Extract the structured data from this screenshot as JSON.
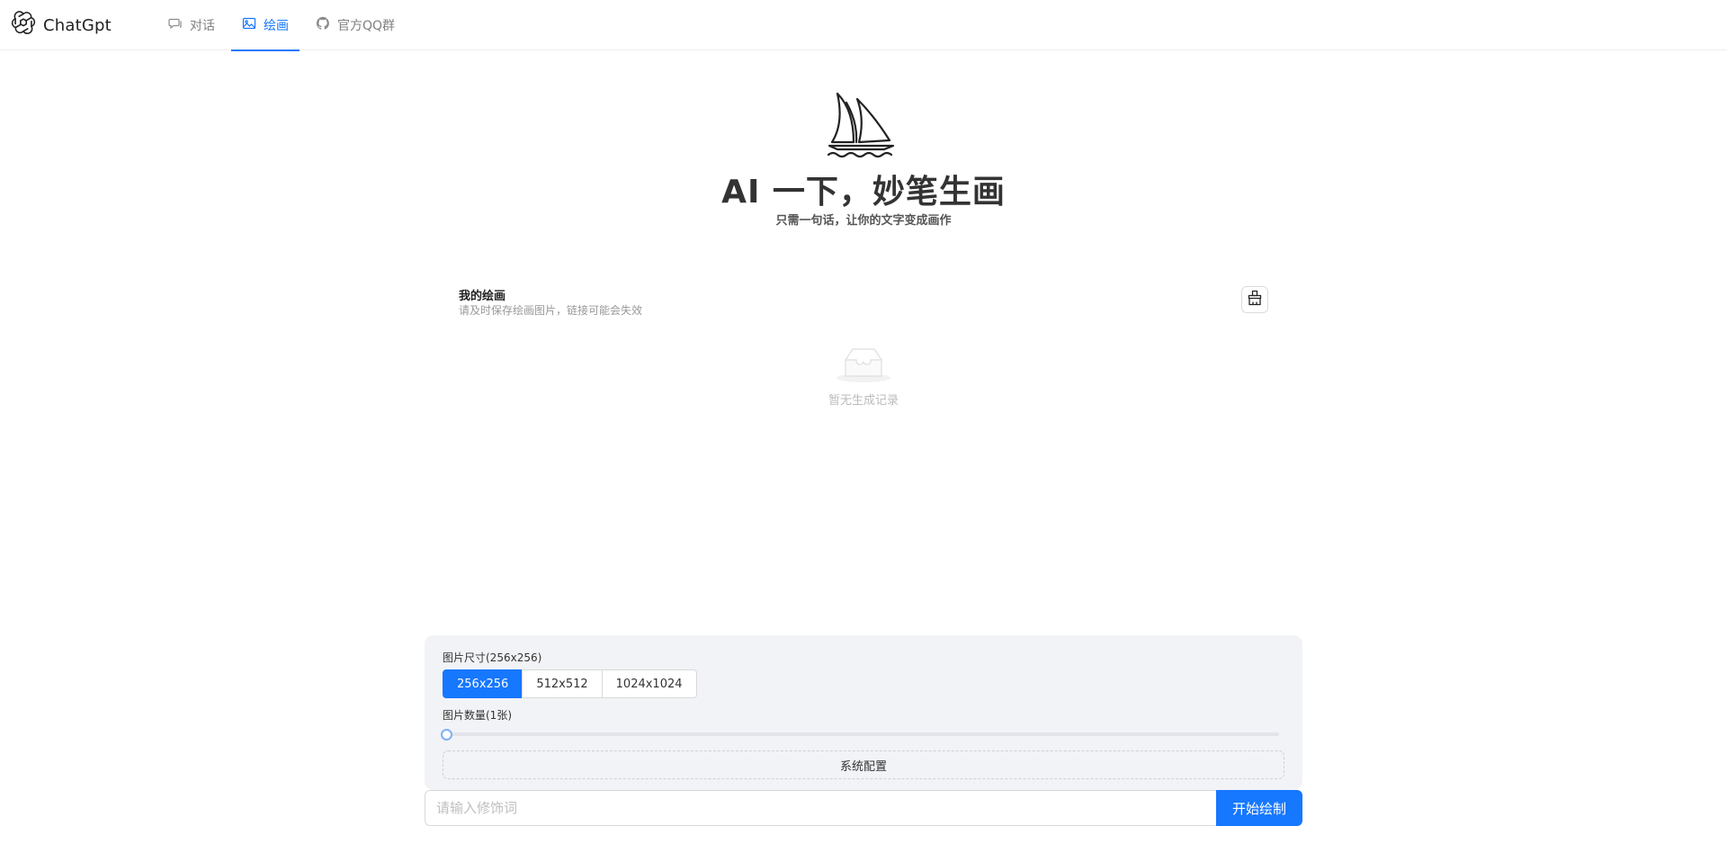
{
  "brand": {
    "name": "ChatGpt",
    "icon": "openai-logo-icon"
  },
  "nav": {
    "items": [
      {
        "label": "对话",
        "icon": "chat-bubble-icon",
        "active": false
      },
      {
        "label": "绘画",
        "icon": "image-icon",
        "active": true
      },
      {
        "label": "官方QQ群",
        "icon": "github-icon",
        "active": false
      }
    ]
  },
  "hero": {
    "icon": "sailboat-icon",
    "title": "AI 一下，妙笔生画",
    "subtitle": "只需一句话，让你的文字变成画作"
  },
  "gallery": {
    "title": "我的绘画",
    "description": "请及时保存绘画图片，链接可能会失效",
    "clear_icon": "broom-icon",
    "empty_icon": "empty-box-icon",
    "empty_text": "暂无生成记录"
  },
  "settings": {
    "size_label": "图片尺寸(256x256)",
    "sizes": [
      "256x256",
      "512x512",
      "1024x1024"
    ],
    "selected_size": "256x256",
    "count_label": "图片数量(1张)",
    "count": 1,
    "config_label": "系统配置"
  },
  "prompt": {
    "placeholder": "请输入修饰词",
    "value": "",
    "submit_label": "开始绘制"
  },
  "colors": {
    "accent": "#1677ff",
    "panel": "#f2f3f7"
  }
}
